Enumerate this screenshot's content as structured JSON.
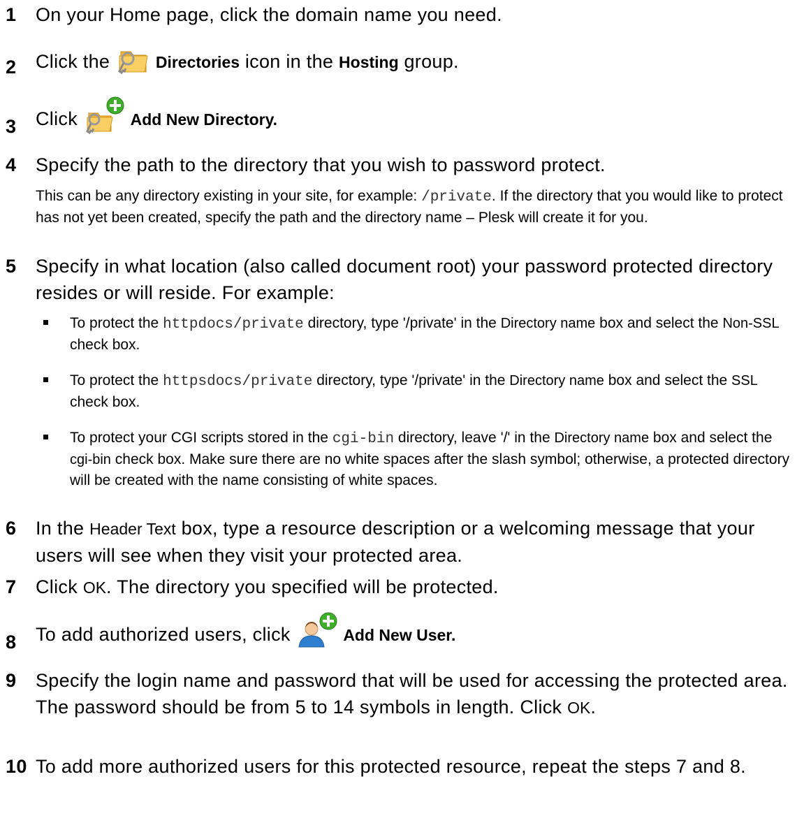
{
  "steps": [
    {
      "num": "1",
      "text": "On your Home page, click the domain name you need."
    },
    {
      "num": "2",
      "pre": "Click the",
      "ui": "Directories",
      "mid": "icon in the",
      "ui2": "Hosting",
      "post": "group.",
      "icon": "folder-key-icon"
    },
    {
      "num": "3",
      "pre": "Click",
      "ui": "Add New Directory.",
      "icon": "add-directory-icon"
    },
    {
      "num": "4",
      "text": "Specify the path to the directory that you wish to password protect.",
      "note": {
        "pre": "This can be any directory existing in your site, for example:",
        "code": "/private",
        "post": ". If the directory that you would like to protect has not yet been created, specify the path and the directory name – Plesk will create it for you."
      }
    },
    {
      "num": "5",
      "text": "Specify in what location (also called document root) your password protected directory resides or will reside. For example:",
      "bullets": [
        {
          "pre": "To protect the",
          "code": "httpdocs/private",
          "mid": "directory, type '/private' in the",
          "ui": "Directory name",
          "mid2": "box and select the",
          "ui2": "Non-SSL",
          "post": "check box."
        },
        {
          "pre": "To protect the",
          "code": "httpsdocs/private",
          "mid": "directory, type '/private' in the",
          "ui": "Directory name",
          "mid2": "box and select the",
          "ui2": "SSL",
          "post": "check box."
        },
        {
          "pre": "To protect your CGI scripts stored in the",
          "code": "cgi-bin",
          "mid": "directory, leave '/' in the",
          "ui": "Directory name",
          "mid2": "box and select the",
          "ui2": "cgi-bin",
          "post": "check box. Make sure there are no white spaces after the slash symbol; otherwise, a protected directory will be created with the name consisting of white spaces."
        }
      ]
    },
    {
      "num": "6",
      "pre": "In the",
      "ui": "Header Text",
      "post": "box, type a resource description or a welcoming message that your users will see when they visit your protected area."
    },
    {
      "num": "7",
      "pre": "Click",
      "ui": "OK",
      "post": ". The directory you specified will be protected."
    },
    {
      "num": "8",
      "pre": "To add authorized users, click",
      "ui": "Add New User.",
      "icon": "add-user-icon"
    },
    {
      "num": "9",
      "pre": "Specify the login name and password that will be used for accessing the protected area. The password should be from 5 to 14 symbols in length. Click",
      "ui": "OK",
      "post": "."
    },
    {
      "num": "10",
      "text": "To add more authorized users for this protected resource, repeat the steps 7 and 8."
    }
  ]
}
